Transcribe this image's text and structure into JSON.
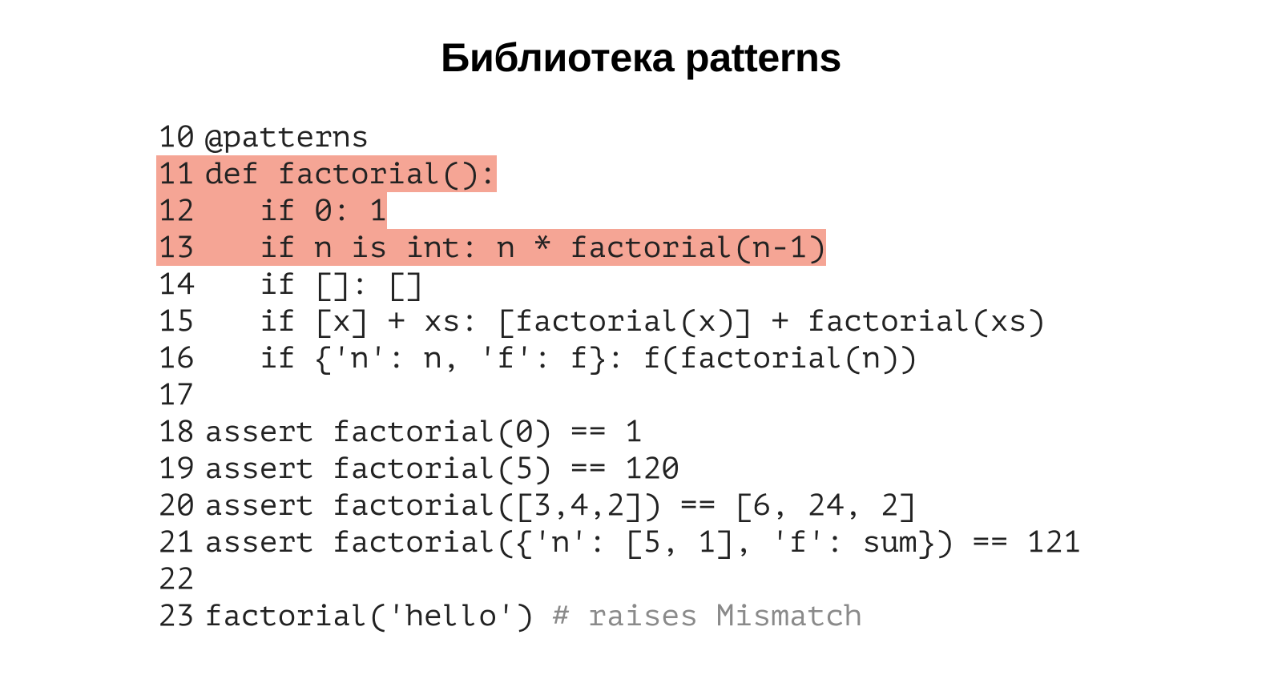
{
  "title": "Библиотека patterns",
  "code": {
    "lines": [
      {
        "num": "10",
        "text": "@patterns",
        "highlight": false
      },
      {
        "num": "11",
        "text": "def factorial():",
        "highlight": true
      },
      {
        "num": "12",
        "text": "   if 0: 1",
        "highlight": true
      },
      {
        "num": "13",
        "text": "   if n is int: n * factorial(n-1)",
        "highlight": true
      },
      {
        "num": "14",
        "text": "   if []: []",
        "highlight": false
      },
      {
        "num": "15",
        "text": "   if [x] + xs: [factorial(x)] + factorial(xs)",
        "highlight": false
      },
      {
        "num": "16",
        "text": "   if {'n': n, 'f': f}: f(factorial(n))",
        "highlight": false
      },
      {
        "num": "17",
        "text": "",
        "highlight": false
      },
      {
        "num": "18",
        "text": "assert factorial(0) == 1",
        "highlight": false
      },
      {
        "num": "19",
        "text": "assert factorial(5) == 120",
        "highlight": false
      },
      {
        "num": "20",
        "text": "assert factorial([3,4,2]) == [6, 24, 2]",
        "highlight": false
      },
      {
        "num": "21",
        "text": "assert factorial({'n': [5, 1], 'f': sum}) == 121",
        "highlight": false
      },
      {
        "num": "22",
        "text": "",
        "highlight": false
      },
      {
        "num": "23",
        "text": "factorial('hello') ",
        "comment": "# raises Mismatch",
        "highlight": false
      }
    ]
  }
}
